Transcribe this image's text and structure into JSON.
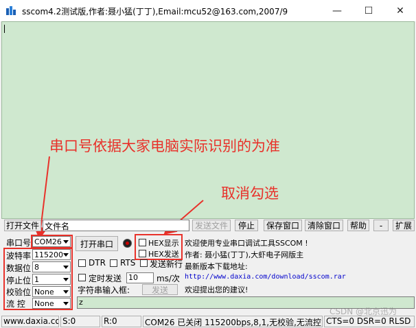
{
  "window": {
    "title": "sscom4.2测试版,作者:聂小猛(丁丁),Email:mcu52@163.com,2007/9",
    "app_icon": "sscom-app-icon",
    "minimize_glyph": "—",
    "maximize_glyph": "☐",
    "close_glyph": "✕"
  },
  "annotations": {
    "port_note": "串口号依据大家电脑实际识别的为准",
    "hex_note": "取消勾选",
    "color": "#e8312a"
  },
  "file_row": {
    "open_file_label": "打开文件",
    "filename_label": "文件名",
    "send_file_label": "发送文件",
    "stop_label": "停止",
    "save_window_label": "保存窗口",
    "clear_window_label": "清除窗口",
    "help_label": "帮助",
    "minus_label": "-",
    "expand_label": "扩展"
  },
  "serial": {
    "port_label": "串口号",
    "port_value": "COM26",
    "baud_label": "波特率",
    "baud_value": "115200",
    "databits_label": "数据位",
    "databits_value": "8",
    "stopbits_label": "停止位",
    "stopbits_value": "1",
    "parity_label": "校验位",
    "parity_value": "None",
    "flow_label": "流 控",
    "flow_value": "None"
  },
  "controls": {
    "open_port_label": "打开串口",
    "hex_display_label": "HEX显示",
    "hex_send_label": "HEX发送",
    "dtr_label": "DTR",
    "rts_label": "RTS",
    "newline_label": "发送新行",
    "timed_send_label": "定时发送",
    "interval_value": "10",
    "interval_unit": "ms/次",
    "input_label": "字符串输入框:",
    "send_label": "发送",
    "input_value": "z"
  },
  "info": {
    "line1": "欢迎使用专业串口调试工具SSCOM !",
    "line2": "作者: 聂小猛(丁丁),大虾电子网版主",
    "line3": "最新版本下载地址:",
    "link": "http://www.daxia.com/download/sscom.rar",
    "line4": "欢迎提出您的建议!"
  },
  "status": {
    "site": "www.daxia.com",
    "sent": "S:0",
    "received": "R:0",
    "port_state": "COM26 已关闭  115200bps,8,1,无校验,无流控",
    "lines": "CTS=0 DSR=0 RLSD",
    "watermark": "CSDN @北京迅为"
  }
}
